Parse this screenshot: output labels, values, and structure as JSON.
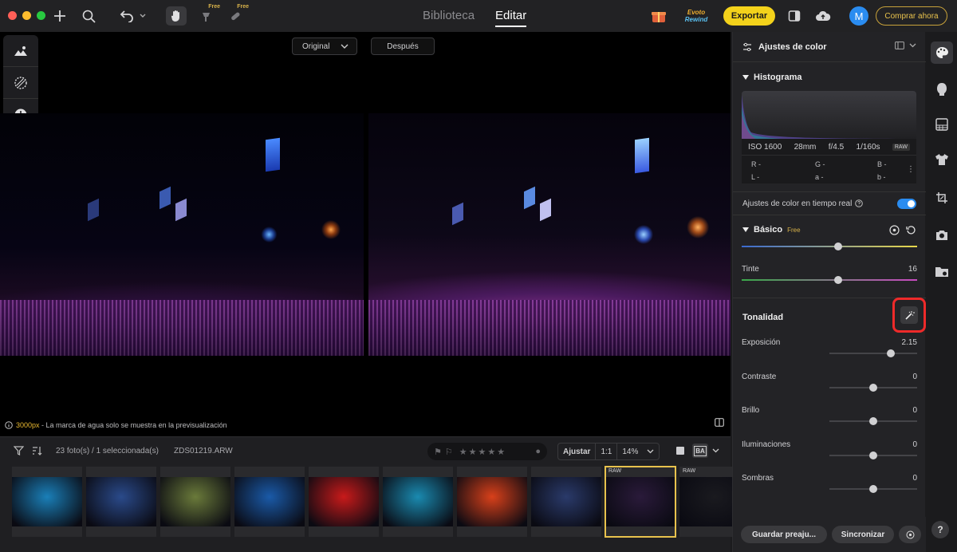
{
  "titlebar": {
    "free_label_1": "Free",
    "free_label_2": "Free",
    "modes": [
      "Biblioteca",
      "Editar"
    ],
    "active_mode": "Editar",
    "rewind_line1": "Evoto",
    "rewind_line2": "Rewind",
    "export_label": "Exportar",
    "avatar_initial": "M",
    "buy_label": "Comprar ahora"
  },
  "canvas": {
    "compare_mode": "Original",
    "after_label": "Después",
    "watermark_size": "3000px",
    "watermark_text": " - La marca de agua solo se muestra en la previsualización"
  },
  "filmstrip": {
    "count_text": "23 foto(s) / 1 seleccionada(s)",
    "filename": "ZDS01219.ARW",
    "fit_label": "Ajustar",
    "one_to_one": "1:1",
    "zoom_value": "14%",
    "ba_label": "BA",
    "raw_label": "RAW",
    "thumb_colors": [
      "#1a7fb8",
      "#2a4a8a",
      "#6a7a3a",
      "#1a5aa8",
      "#c81a1a",
      "#1a8ab0",
      "#d8401a",
      "#2a3a6a",
      "#2a1a3a",
      "#1a1a1f"
    ]
  },
  "panel": {
    "title": "Ajustes de color",
    "histogram_title": "Histograma",
    "iso": "ISO 1600",
    "focal": "28mm",
    "aperture": "f/4.5",
    "shutter": "1/160s",
    "raw_badge": "RAW",
    "r_label": "R -",
    "g_label": "G -",
    "b_label": "B -",
    "l_label": "L -",
    "a_label": "a -",
    "bb_label": "b -",
    "live_label": "Ajustes de color en tiempo real",
    "basic_title": "Básico",
    "free_badge": "Free",
    "tint_label": "Tinte",
    "tint_value": "16",
    "tonality_title": "Tonalidad",
    "sliders": [
      {
        "label": "Exposición",
        "value": "2.15",
        "pos": 0.7
      },
      {
        "label": "Contraste",
        "value": "0",
        "pos": 0.5
      },
      {
        "label": "Brillo",
        "value": "0",
        "pos": 0.5
      },
      {
        "label": "Iluminaciones",
        "value": "0",
        "pos": 0.5
      },
      {
        "label": "Sombras",
        "value": "0",
        "pos": 0.5
      }
    ],
    "temp_pos": 0.55,
    "tint_pos": 0.55,
    "save_preset": "Guardar preaju...",
    "sync_label": "Sincronizar"
  },
  "colors": {
    "accent_yellow": "#f3d21b",
    "toggle_blue": "#2a8cf0",
    "highlight_red": "#ee2a2a"
  }
}
